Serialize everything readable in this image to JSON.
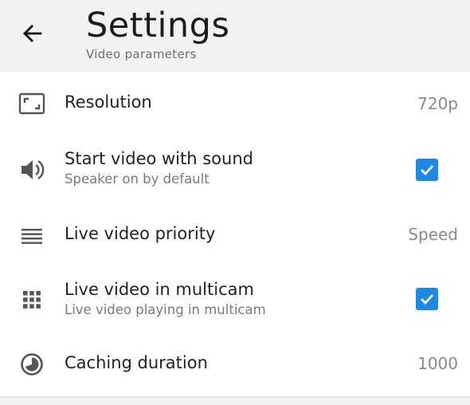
{
  "header": {
    "title": "Settings",
    "subtitle": "Video parameters",
    "back_icon": "arrow-left-icon"
  },
  "colors": {
    "accent": "#1e88e5",
    "header_bg": "#f2f2f2",
    "icon": "#555555"
  },
  "settings": {
    "resolution": {
      "label": "Resolution",
      "value": "720p",
      "icon": "aspect-ratio-icon"
    },
    "start_with_sound": {
      "label": "Start video with sound",
      "sublabel": "Speaker on by default",
      "checked": true,
      "icon": "speaker-icon"
    },
    "live_priority": {
      "label": "Live video priority",
      "value": "Speed",
      "icon": "menu-lines-icon"
    },
    "live_multicam": {
      "label": "Live video in multicam",
      "sublabel": "Live video playing in multicam",
      "checked": true,
      "icon": "grid-icon"
    },
    "caching": {
      "label": "Caching duration",
      "value": "1000",
      "icon": "timelapse-icon"
    }
  }
}
